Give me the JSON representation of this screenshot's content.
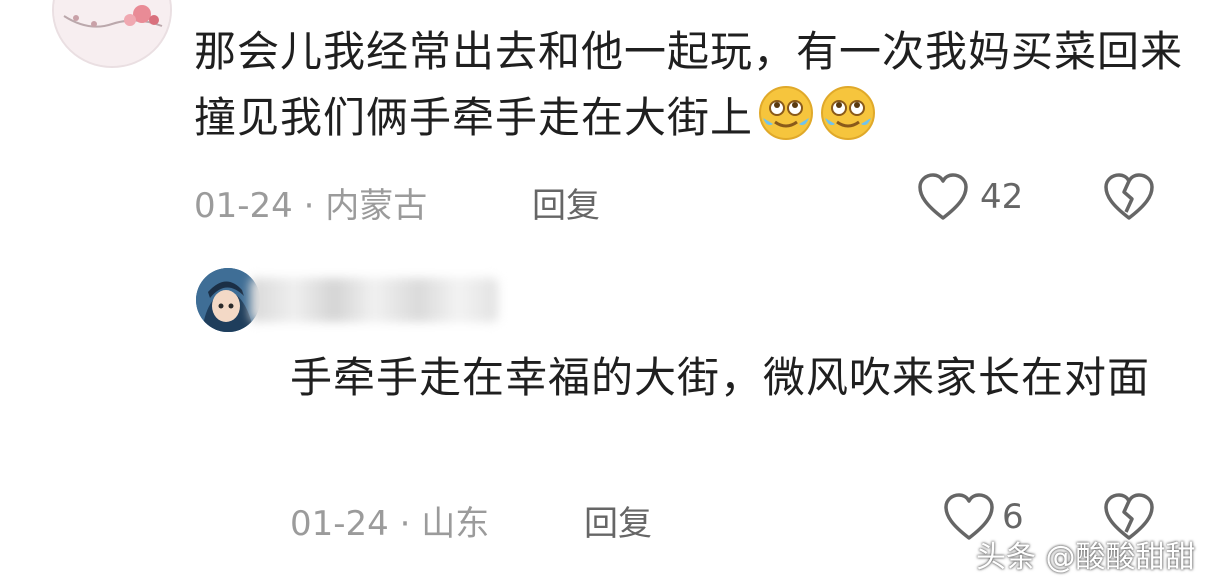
{
  "comment_1": {
    "text": "那会儿我经常出去和他一起玩，有一次我妈买菜回来撞见我们俩手牵手走在大街上",
    "emojis": [
      "crying-laughing-emoji",
      "crying-laughing-emoji"
    ],
    "date": "01-24",
    "separator": "·",
    "location": "内蒙古",
    "reply_label": "回复",
    "like_count": "42"
  },
  "comment_2": {
    "text": "手牵手走在幸福的大街，微风吹来家长在对面",
    "date": "01-24",
    "separator": "·",
    "location": "山东",
    "reply_label": "回复",
    "like_count": "6"
  },
  "watermark": {
    "text": "头条 @酸酸甜甜"
  },
  "colors": {
    "text_primary": "#1f1f1f",
    "text_meta": "#9b9b9b",
    "icon": "#666666",
    "emoji_yellow": "#f6c53d"
  }
}
